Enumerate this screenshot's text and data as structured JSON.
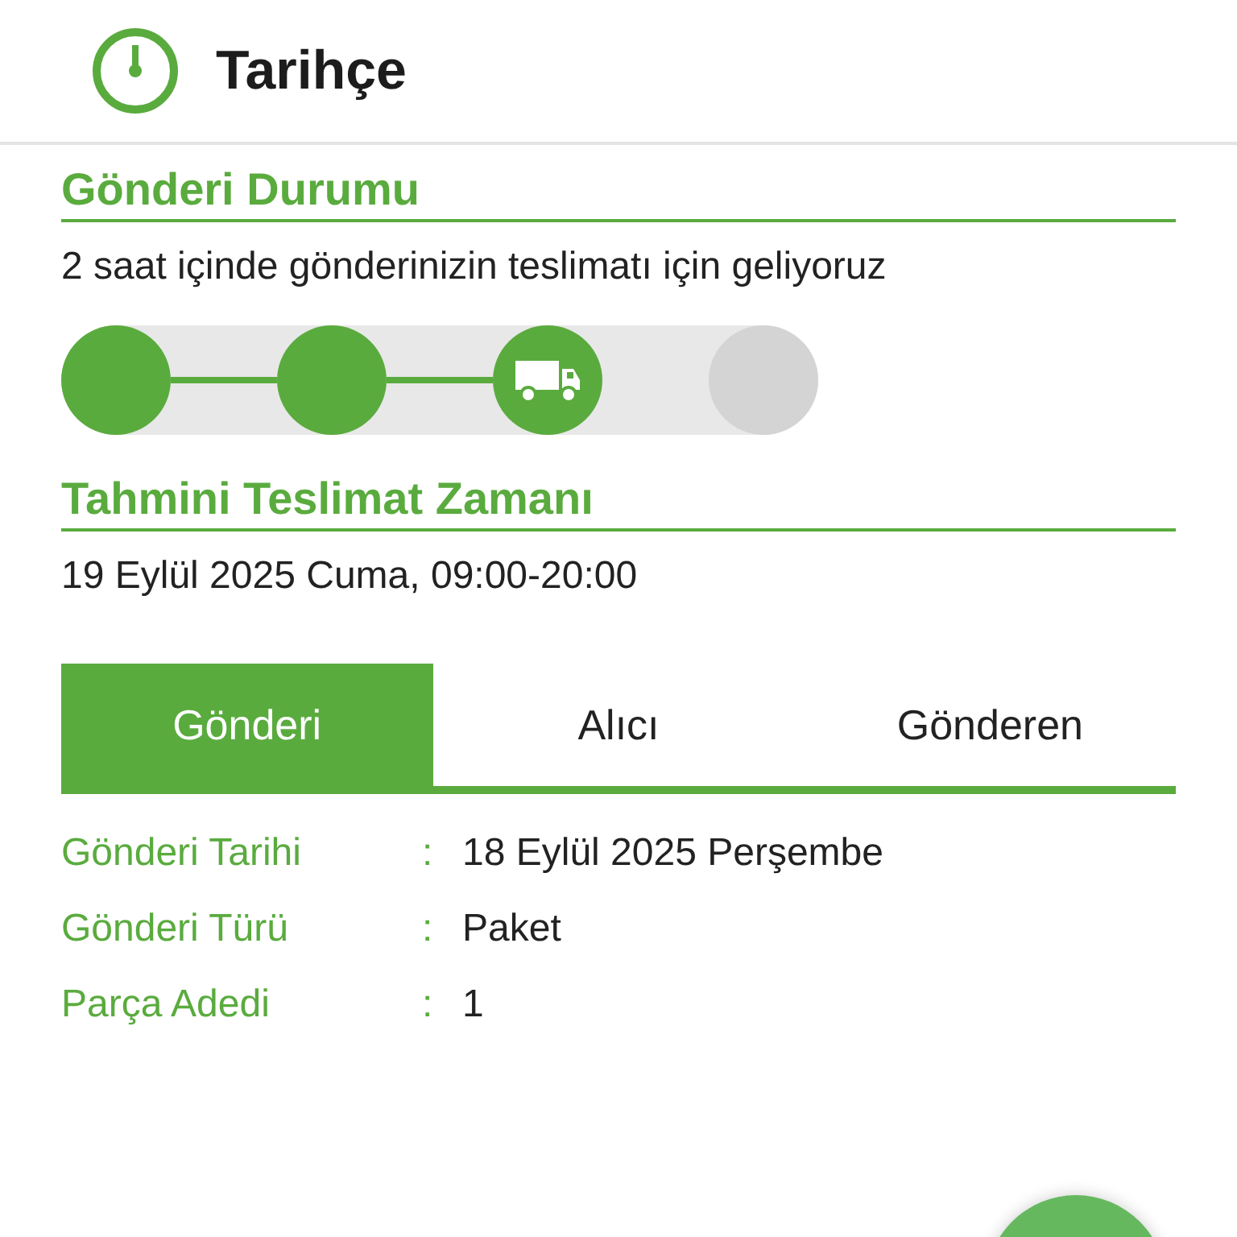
{
  "header": {
    "title": "Tarihçe"
  },
  "status": {
    "title": "Gönderi Durumu",
    "message": "2 saat içinde gönderinizin teslimatı için geliyoruz",
    "steps": [
      {
        "kind": "done"
      },
      {
        "kind": "done"
      },
      {
        "kind": "current"
      },
      {
        "kind": "pending"
      }
    ]
  },
  "estimate": {
    "title": "Tahmini Teslimat Zamanı",
    "value": "19 Eylül 2025 Cuma, 09:00-20:00"
  },
  "tabs": [
    {
      "label": "Gönderi",
      "selected": true
    },
    {
      "label": "Alıcı",
      "selected": false
    },
    {
      "label": "Gönderen",
      "selected": false
    }
  ],
  "details": [
    {
      "label": "Gönderi Tarihi",
      "separator": ":",
      "value": "18 Eylül 2025 Perşembe"
    },
    {
      "label": "Gönderi Türü",
      "separator": ":",
      "value": "Paket"
    },
    {
      "label": "Parça Adedi",
      "separator": ":",
      "value": "1"
    }
  ]
}
